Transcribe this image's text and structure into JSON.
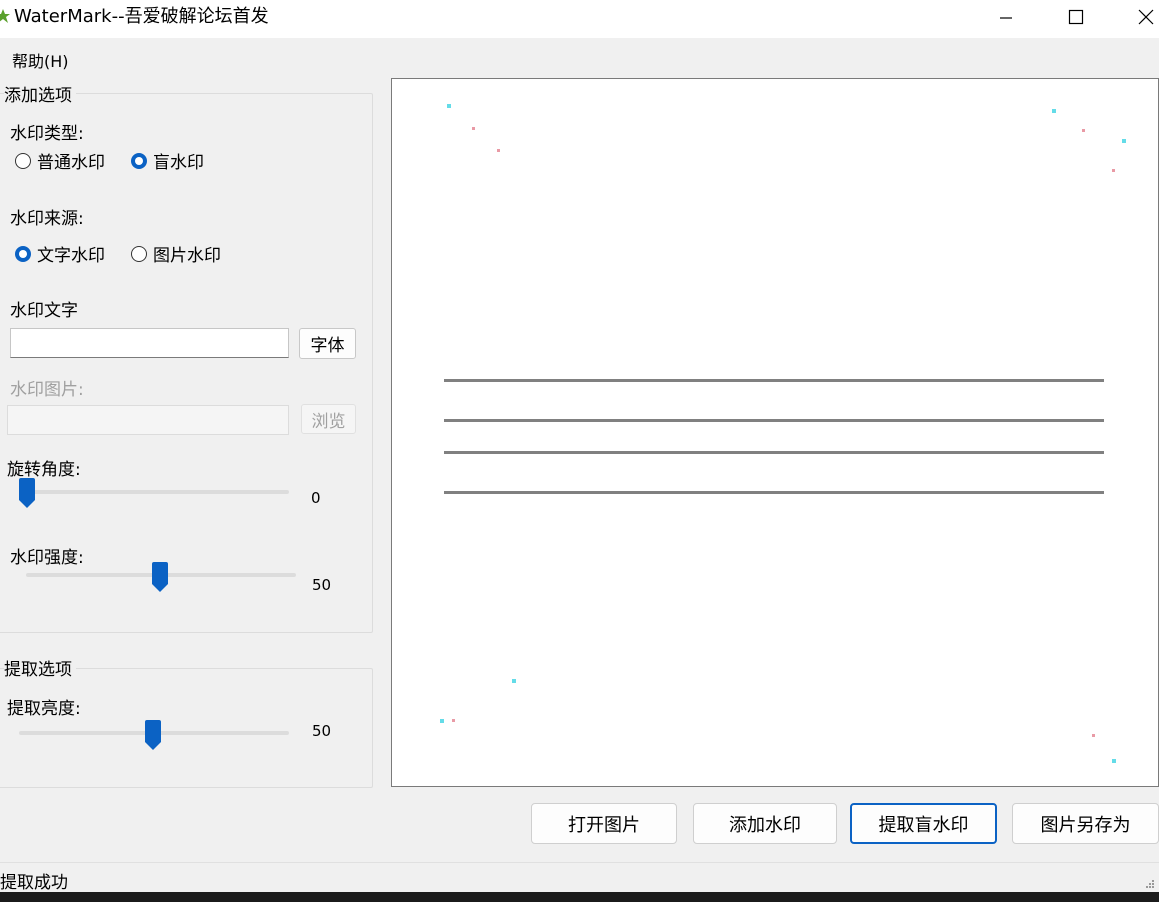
{
  "window": {
    "title": "WaterMark--吾爱破解论坛首发"
  },
  "menu": {
    "help": "帮助(H)"
  },
  "add_options": {
    "group_title": "添加选项",
    "type_label": "水印类型:",
    "type_normal": "普通水印",
    "type_blind": "盲水印",
    "type_selected": "盲水印",
    "source_label": "水印来源:",
    "source_text": "文字水印",
    "source_image": "图片水印",
    "source_selected": "文字水印",
    "text_label": "水印文字",
    "text_value": "",
    "font_button": "字体",
    "image_label": "水印图片:",
    "image_value": "",
    "browse_button": "浏览",
    "rotation_label": "旋转角度:",
    "rotation_value": "0",
    "strength_label": "水印强度:",
    "strength_value": "50"
  },
  "extract_options": {
    "group_title": "提取选项",
    "brightness_label": "提取亮度:",
    "brightness_value": "50"
  },
  "buttons": {
    "open": "打开图片",
    "add": "添加水印",
    "extract": "提取盲水印",
    "save_as": "图片另存为"
  },
  "status": {
    "text": "提取成功"
  },
  "colors": {
    "accent": "#0b62c4",
    "window_bg": "#f0f0f0",
    "titlebar_bg": "#ffffff"
  }
}
